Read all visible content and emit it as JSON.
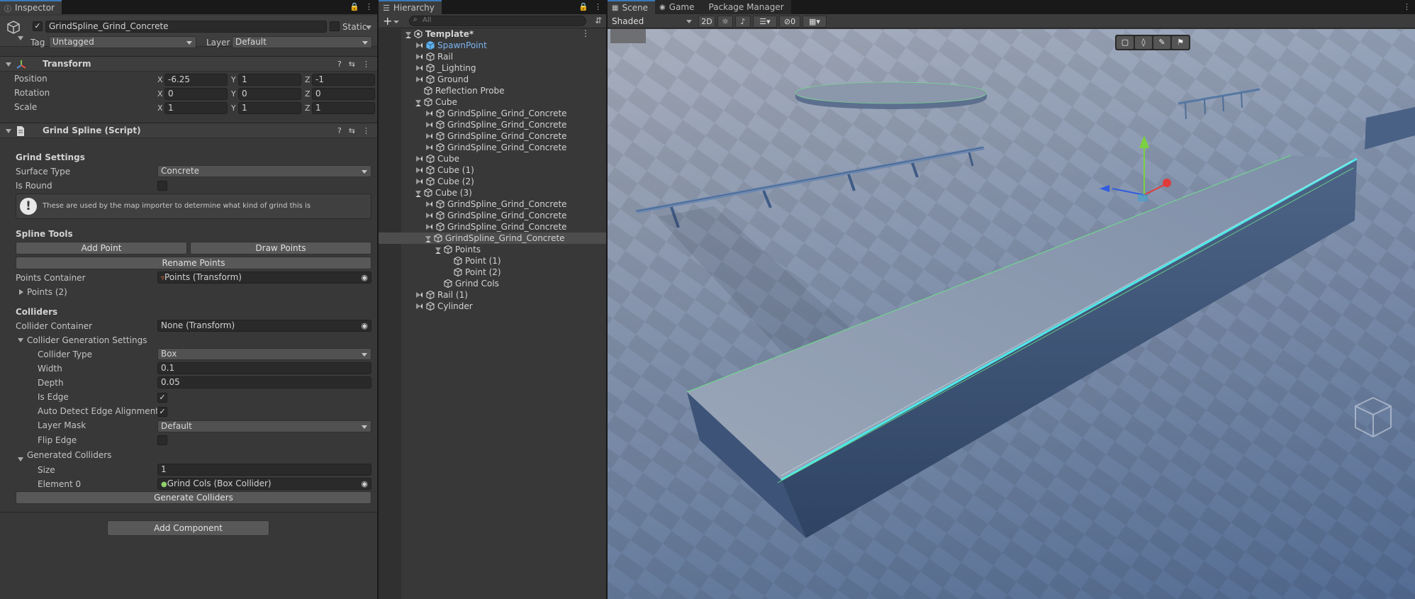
{
  "inspector": {
    "tab_label": "Inspector",
    "object_name": "GrindSpline_Grind_Concrete",
    "static_label": "Static",
    "tag_label": "Tag",
    "tag_value": "Untagged",
    "layer_label": "Layer",
    "layer_value": "Default",
    "transform": {
      "title": "Transform",
      "rows": [
        {
          "label": "Position",
          "x": "-6.25",
          "y": "1",
          "z": "-1"
        },
        {
          "label": "Rotation",
          "x": "0",
          "y": "0",
          "z": "0"
        },
        {
          "label": "Scale",
          "x": "1",
          "y": "1",
          "z": "1"
        }
      ],
      "axis_x": "X",
      "axis_y": "Y",
      "axis_z": "Z"
    },
    "grind_spline": {
      "title": "Grind Spline (Script)",
      "grind_settings": "Grind Settings",
      "surface_type_label": "Surface Type",
      "surface_type_value": "Concrete",
      "is_round_label": "Is Round",
      "info_text": "These are used by the map importer to determine what kind of grind this is",
      "spline_tools": "Spline Tools",
      "add_point": "Add Point",
      "draw_points": "Draw Points",
      "rename_points": "Rename Points",
      "points_container_label": "Points Container",
      "points_container_value": "Points (Transform)",
      "points_list": "Points (2)",
      "colliders": "Colliders",
      "collider_container_label": "Collider Container",
      "collider_container_value": "None (Transform)",
      "collider_gen_settings": "Collider Generation Settings",
      "collider_type_label": "Collider Type",
      "collider_type_value": "Box",
      "width_label": "Width",
      "width_value": "0.1",
      "depth_label": "Depth",
      "depth_value": "0.05",
      "is_edge_label": "Is Edge",
      "auto_detect_label": "Auto Detect Edge Alignment",
      "layer_mask_label": "Layer Mask",
      "layer_mask_value": "Default",
      "flip_edge_label": "Flip Edge",
      "generated_colliders": "Generated Colliders",
      "size_label": "Size",
      "size_value": "1",
      "element0_label": "Element 0",
      "element0_value": "Grind Cols (Box Collider)",
      "generate_colliders": "Generate Colliders"
    },
    "add_component": "Add Component"
  },
  "hierarchy": {
    "tab_label": "Hierarchy",
    "search_placeholder": "All",
    "items": [
      {
        "label": "Template*",
        "depth": 0,
        "expanded": true,
        "arrow": true
      },
      {
        "label": "SpawnPoint",
        "depth": 1,
        "arrow": true,
        "prefab": true
      },
      {
        "label": "Rail",
        "depth": 1,
        "arrow": true
      },
      {
        "label": "_Lighting",
        "depth": 1,
        "arrow": true
      },
      {
        "label": "Ground",
        "depth": 1,
        "arrow": true
      },
      {
        "label": "Reflection Probe",
        "depth": 1,
        "arrow": false
      },
      {
        "label": "Cube",
        "depth": 1,
        "arrow": true,
        "expanded": true
      },
      {
        "label": "GrindSpline_Grind_Concrete",
        "depth": 2,
        "arrow": true
      },
      {
        "label": "GrindSpline_Grind_Concrete",
        "depth": 2,
        "arrow": true
      },
      {
        "label": "GrindSpline_Grind_Concrete",
        "depth": 2,
        "arrow": true
      },
      {
        "label": "GrindSpline_Grind_Concrete",
        "depth": 2,
        "arrow": true
      },
      {
        "label": "Cube",
        "depth": 1,
        "arrow": true
      },
      {
        "label": "Cube (1)",
        "depth": 1,
        "arrow": true
      },
      {
        "label": "Cube (2)",
        "depth": 1,
        "arrow": true
      },
      {
        "label": "Cube (3)",
        "depth": 1,
        "arrow": true,
        "expanded": true
      },
      {
        "label": "GrindSpline_Grind_Concrete",
        "depth": 2,
        "arrow": true
      },
      {
        "label": "GrindSpline_Grind_Concrete",
        "depth": 2,
        "arrow": true
      },
      {
        "label": "GrindSpline_Grind_Concrete",
        "depth": 2,
        "arrow": true
      },
      {
        "label": "GrindSpline_Grind_Concrete",
        "depth": 2,
        "arrow": true,
        "expanded": true,
        "selected": true
      },
      {
        "label": "Points",
        "depth": 3,
        "arrow": true,
        "expanded": true
      },
      {
        "label": "Point (1)",
        "depth": 4,
        "arrow": false
      },
      {
        "label": "Point (2)",
        "depth": 4,
        "arrow": false
      },
      {
        "label": "Grind Cols",
        "depth": 3,
        "arrow": false
      },
      {
        "label": "Rail (1)",
        "depth": 1,
        "arrow": true
      },
      {
        "label": "Cylinder",
        "depth": 1,
        "arrow": true
      }
    ]
  },
  "scene": {
    "tabs": [
      "Scene",
      "Game",
      "Package Manager"
    ],
    "shading_mode": "Shaded",
    "btn_2d": "2D",
    "hidden_count": "0"
  },
  "colors": {
    "accent": "#3a79bb",
    "prefab_text": "#7cb4f0",
    "panel": "#383838"
  }
}
